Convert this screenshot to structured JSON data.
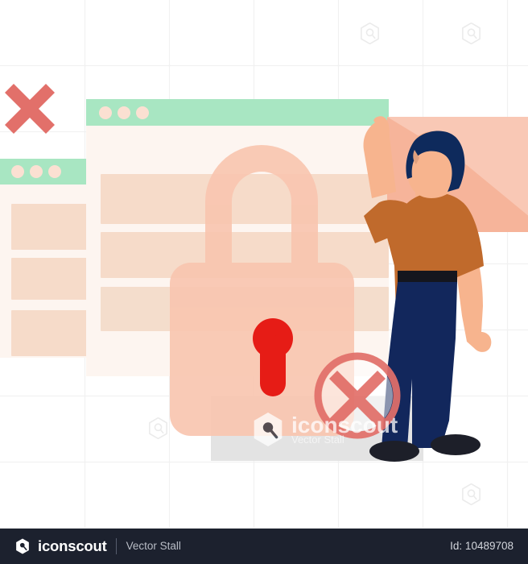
{
  "illustration": {
    "title": "Man facing locked security error screen",
    "palette": {
      "background": "#ffffff",
      "grid_line": "#f2f2f2",
      "window_header_green": "#a8e6c2",
      "window_header_dot": "#fbe0d2",
      "window_body": "#fdf4ef",
      "content_block": "#f6dbc9",
      "content_block_alt": "#f4e0d2",
      "lock_body": "#f9c6b0",
      "lock_shackle": "#f9c6b0",
      "keyhole_red": "#e61c16",
      "cross_red": "#e2706a",
      "skin": "#f7b48e",
      "shirt_orange": "#c06a2c",
      "pants_navy": "#12275c",
      "hair_navy": "#0e2a5c",
      "shoe_black": "#1d1f29",
      "belt_black": "#14161e",
      "panel_salmon": "#f6b49a",
      "panel_salmon_light": "#f9cbba",
      "floor_gray": "#e0e0e0",
      "footer_bg": "#1c212e"
    },
    "elements": {
      "cross_mark_left": "x-mark",
      "browser_window_back": "browser-window",
      "browser_window_front": "browser-window",
      "padlock": "padlock",
      "keyhole": "keyhole",
      "error_badge": "circle-x-badge",
      "person": "man-standing-back-view",
      "envelope_panel": "envelope-panel"
    }
  },
  "watermark": {
    "brand": "iconscout",
    "author": "Vector Stall",
    "logo_icon": "iconscout-hex-logo"
  },
  "footer": {
    "brand": "iconscout",
    "author": "Vector Stall",
    "id_label": "Id: 10489708",
    "logo_icon": "iconscout-hex-logo"
  },
  "tiled_watermarks": {
    "icon": "iconscout-hex-logo",
    "count": 8
  }
}
